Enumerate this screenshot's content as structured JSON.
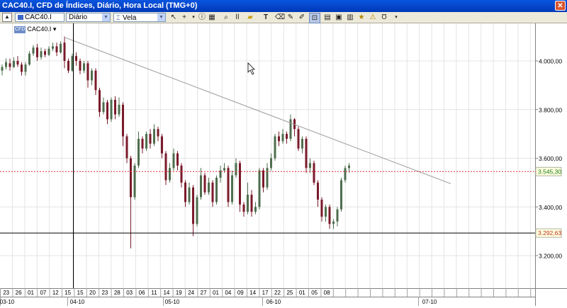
{
  "window": {
    "title": "CAC40.I, CFD de Índices, Diário, Hora Local (TMG+0)",
    "close_glyph": "✕"
  },
  "toolbar": {
    "symbol": "CAC40.I",
    "period": "Diário",
    "chart_type": "Vela",
    "tools": [
      "cursor-arrow",
      "crosshair",
      "info",
      "grid",
      "zoom",
      "folder",
      "text",
      "eraser",
      "pencil",
      "magnet",
      "bar-style",
      "window-style",
      "template",
      "alert",
      "magnet2",
      "dropdown"
    ]
  },
  "chart": {
    "symbol_tag": "CAC40.I ▾",
    "y_ticks": [
      "4.000,00",
      "3.800,00",
      "3.600,00",
      "3.400,00",
      "3.200,00"
    ],
    "last_price": "3.545,30",
    "crosshair_price": "3.292,63",
    "x_day_labels": [
      "23",
      "26",
      "01",
      "07",
      "12",
      "15",
      "15",
      "20",
      "23",
      "28",
      "03",
      "06",
      "11",
      "14",
      "19",
      "24",
      "27",
      "01",
      "04",
      "09",
      "14",
      "17",
      "22",
      "25",
      "01",
      "05",
      "08"
    ],
    "x_month_labels": [
      "03-10",
      "04-10",
      "05-10",
      "06-10",
      "07-10"
    ],
    "colors": {
      "up": "#4e6e4e",
      "down": "#7a1a2a",
      "last_line": "#e03030",
      "price_tag_bg": "#ffffe0"
    }
  },
  "chart_data": {
    "type": "candlestick",
    "y_ticks": [
      4000,
      3800,
      3600,
      3400,
      3200
    ],
    "ylim": [
      3130,
      4120
    ],
    "last_price": 3545.3,
    "crosshair_price": 3292.63,
    "candles": [
      [
        3960,
        3975,
        3940,
        3985
      ],
      [
        3975,
        3995,
        3965,
        4010
      ],
      [
        3990,
        3975,
        3960,
        4010
      ],
      [
        3975,
        4000,
        3970,
        4015
      ],
      [
        4000,
        3985,
        3975,
        4020
      ],
      [
        3985,
        3955,
        3940,
        3995
      ],
      [
        3955,
        3985,
        3940,
        3995
      ],
      [
        3985,
        4030,
        3980,
        4040
      ],
      [
        4030,
        4055,
        4020,
        4065
      ],
      [
        4055,
        4015,
        4000,
        4070
      ],
      [
        4015,
        4040,
        4005,
        4055
      ],
      [
        4040,
        4025,
        4015,
        4050
      ],
      [
        4025,
        4050,
        4020,
        4060
      ],
      [
        4050,
        4060,
        4040,
        4075
      ],
      [
        4060,
        4035,
        4020,
        4075
      ],
      [
        4035,
        4070,
        4030,
        4080
      ],
      [
        4075,
        4000,
        3970,
        4100
      ],
      [
        4000,
        3960,
        3950,
        4010
      ],
      [
        3960,
        4020,
        3955,
        4030
      ],
      [
        4020,
        4000,
        3980,
        4035
      ],
      [
        4000,
        3960,
        3945,
        4010
      ],
      [
        3960,
        3990,
        3950,
        4000
      ],
      [
        3990,
        3920,
        3890,
        4000
      ],
      [
        3920,
        3960,
        3900,
        3970
      ],
      [
        3960,
        3880,
        3860,
        3970
      ],
      [
        3880,
        3790,
        3770,
        3890
      ],
      [
        3790,
        3830,
        3780,
        3850
      ],
      [
        3830,
        3760,
        3740,
        3840
      ],
      [
        3760,
        3840,
        3750,
        3850
      ],
      [
        3840,
        3780,
        3760,
        3855
      ],
      [
        3780,
        3820,
        3770,
        3850
      ],
      [
        3820,
        3690,
        3650,
        3830
      ],
      [
        3690,
        3600,
        3580,
        3700
      ],
      [
        3600,
        3440,
        3230,
        3610
      ],
      [
        3440,
        3570,
        3430,
        3580
      ],
      [
        3570,
        3680,
        3560,
        3710
      ],
      [
        3680,
        3640,
        3620,
        3690
      ],
      [
        3640,
        3700,
        3630,
        3710
      ],
      [
        3700,
        3660,
        3640,
        3720
      ],
      [
        3660,
        3720,
        3650,
        3740
      ],
      [
        3720,
        3690,
        3670,
        3730
      ],
      [
        3690,
        3620,
        3600,
        3700
      ],
      [
        3620,
        3510,
        3490,
        3630
      ],
      [
        3510,
        3560,
        3500,
        3580
      ],
      [
        3560,
        3620,
        3550,
        3640
      ],
      [
        3620,
        3570,
        3550,
        3630
      ],
      [
        3570,
        3500,
        3480,
        3580
      ],
      [
        3500,
        3420,
        3400,
        3510
      ],
      [
        3420,
        3480,
        3410,
        3500
      ],
      [
        3480,
        3330,
        3280,
        3490
      ],
      [
        3330,
        3440,
        3320,
        3450
      ],
      [
        3440,
        3530,
        3430,
        3560
      ],
      [
        3530,
        3460,
        3450,
        3540
      ],
      [
        3460,
        3500,
        3450,
        3520
      ],
      [
        3500,
        3420,
        3400,
        3510
      ],
      [
        3420,
        3520,
        3410,
        3530
      ],
      [
        3520,
        3550,
        3500,
        3570
      ],
      [
        3550,
        3560,
        3540,
        3580
      ],
      [
        3560,
        3420,
        3400,
        3570
      ],
      [
        3420,
        3530,
        3410,
        3550
      ],
      [
        3530,
        3580,
        3520,
        3600
      ],
      [
        3580,
        3410,
        3380,
        3590
      ],
      [
        3410,
        3380,
        3360,
        3420
      ],
      [
        3380,
        3450,
        3370,
        3500
      ],
      [
        3450,
        3380,
        3360,
        3470
      ],
      [
        3380,
        3400,
        3370,
        3420
      ],
      [
        3400,
        3550,
        3390,
        3560
      ],
      [
        3550,
        3480,
        3460,
        3560
      ],
      [
        3480,
        3560,
        3470,
        3580
      ],
      [
        3560,
        3600,
        3550,
        3620
      ],
      [
        3600,
        3690,
        3590,
        3700
      ],
      [
        3690,
        3670,
        3650,
        3710
      ],
      [
        3670,
        3700,
        3660,
        3720
      ],
      [
        3700,
        3680,
        3660,
        3710
      ],
      [
        3680,
        3760,
        3670,
        3780
      ],
      [
        3760,
        3720,
        3690,
        3765
      ],
      [
        3720,
        3640,
        3630,
        3730
      ],
      [
        3640,
        3680,
        3620,
        3690
      ],
      [
        3680,
        3560,
        3540,
        3690
      ],
      [
        3560,
        3580,
        3540,
        3600
      ],
      [
        3580,
        3500,
        3490,
        3590
      ],
      [
        3500,
        3430,
        3400,
        3510
      ],
      [
        3430,
        3360,
        3340,
        3440
      ],
      [
        3360,
        3400,
        3340,
        3410
      ],
      [
        3400,
        3330,
        3310,
        3410
      ],
      [
        3330,
        3340,
        3310,
        3350
      ],
      [
        3340,
        3390,
        3320,
        3400
      ],
      [
        3390,
        3510,
        3380,
        3520
      ],
      [
        3510,
        3560,
        3500,
        3570
      ],
      [
        3560,
        3570,
        3540,
        3580
      ]
    ],
    "trendline": {
      "from_candle_index": 16,
      "from_price": 4090,
      "to_price": 3510
    }
  }
}
